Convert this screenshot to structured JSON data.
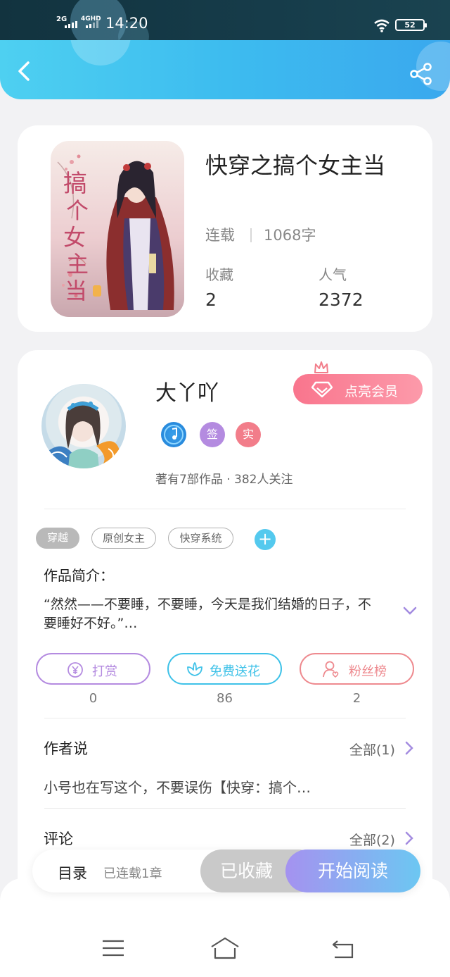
{
  "status_bar": {
    "sim1": "2G",
    "sim2": "4GHD",
    "time": "14:20",
    "battery": "52"
  },
  "book": {
    "title": "快穿之搞个女主当",
    "status": "连载",
    "word_count": "1068字",
    "stats": [
      {
        "label": "收藏",
        "value": "2"
      },
      {
        "label": "人气",
        "value": "2372"
      }
    ]
  },
  "author": {
    "name": "大丫吖",
    "vip_button": "点亮会员",
    "badges": [
      {
        "icon": "music-medal-icon",
        "text": "",
        "color": "#2f9be8"
      },
      {
        "icon": "sign-badge",
        "text": "签",
        "color": "#b48be0"
      },
      {
        "icon": "real-name-badge",
        "text": "实",
        "color": "#f27d8a"
      }
    ],
    "works_info": "著有7部作品 · 382人关注"
  },
  "tags": [
    "穿越",
    "原创女主",
    "快穿系统"
  ],
  "intro": {
    "title": "作品简介：",
    "text": "“然然——不要睡，不要睡，今天是我们结婚的日子，不要睡好不好。”…"
  },
  "actions": [
    {
      "label": "打赏",
      "count": "0",
      "color": "#b48be0",
      "icon": "yen-icon"
    },
    {
      "label": "免费送花",
      "count": "86",
      "color": "#3fc2e8",
      "icon": "flower-icon"
    },
    {
      "label": "粉丝榜",
      "count": "2",
      "color": "#ee8a8f",
      "icon": "fan-user-icon"
    }
  ],
  "author_says": {
    "title": "作者说",
    "all": "全部(1)",
    "text": "小号也在写这个，不要误伤【快穿：搞个…"
  },
  "comments": {
    "title": "评论",
    "all": "全部(2)"
  },
  "bottom_bar": {
    "menu": "目录",
    "chapters": "已连载1章",
    "collected": "已收藏",
    "read": "开始阅读"
  },
  "colors": {
    "accent": "#3dbcef",
    "vip": "#f9758d",
    "purple": "#a592f0"
  }
}
